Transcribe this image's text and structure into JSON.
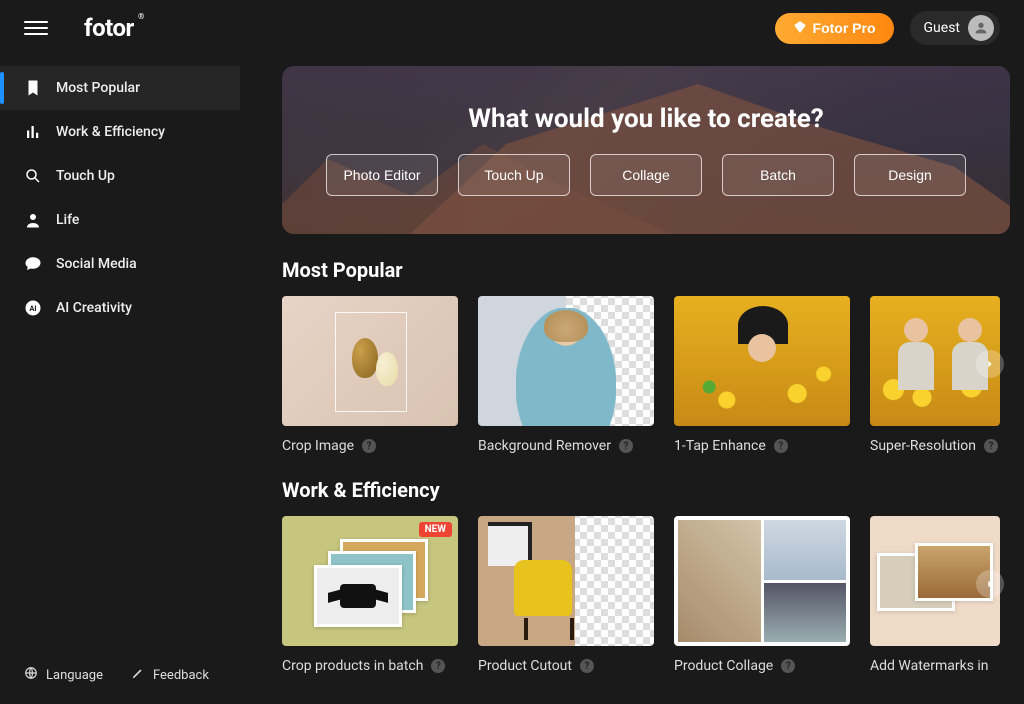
{
  "header": {
    "logo": "fotor",
    "pro_button": "Fotor Pro",
    "guest_label": "Guest"
  },
  "sidebar": {
    "items": [
      {
        "label": "Most Popular",
        "icon": "bookmark-icon",
        "active": true
      },
      {
        "label": "Work & Efficiency",
        "icon": "bars-icon",
        "active": false
      },
      {
        "label": "Touch Up",
        "icon": "dial-icon",
        "active": false
      },
      {
        "label": "Life",
        "icon": "person-icon",
        "active": false
      },
      {
        "label": "Social Media",
        "icon": "chat-icon",
        "active": false
      },
      {
        "label": "AI Creativity",
        "icon": "ai-icon",
        "active": false
      }
    ],
    "bottom": {
      "language": "Language",
      "feedback": "Feedback"
    }
  },
  "hero": {
    "title": "What would you like to create?",
    "buttons": [
      "Photo Editor",
      "Touch Up",
      "Collage",
      "Batch",
      "Design"
    ]
  },
  "sections": [
    {
      "title": "Most Popular",
      "cards": [
        {
          "label": "Crop Image"
        },
        {
          "label": "Background Remover"
        },
        {
          "label": "1-Tap Enhance"
        },
        {
          "label": "Super-Resolution"
        }
      ]
    },
    {
      "title": "Work & Efficiency",
      "cards": [
        {
          "label": "Crop products in batch",
          "badge": "NEW"
        },
        {
          "label": "Product Cutout"
        },
        {
          "label": "Product Collage"
        },
        {
          "label": "Add Watermarks in"
        }
      ]
    }
  ]
}
